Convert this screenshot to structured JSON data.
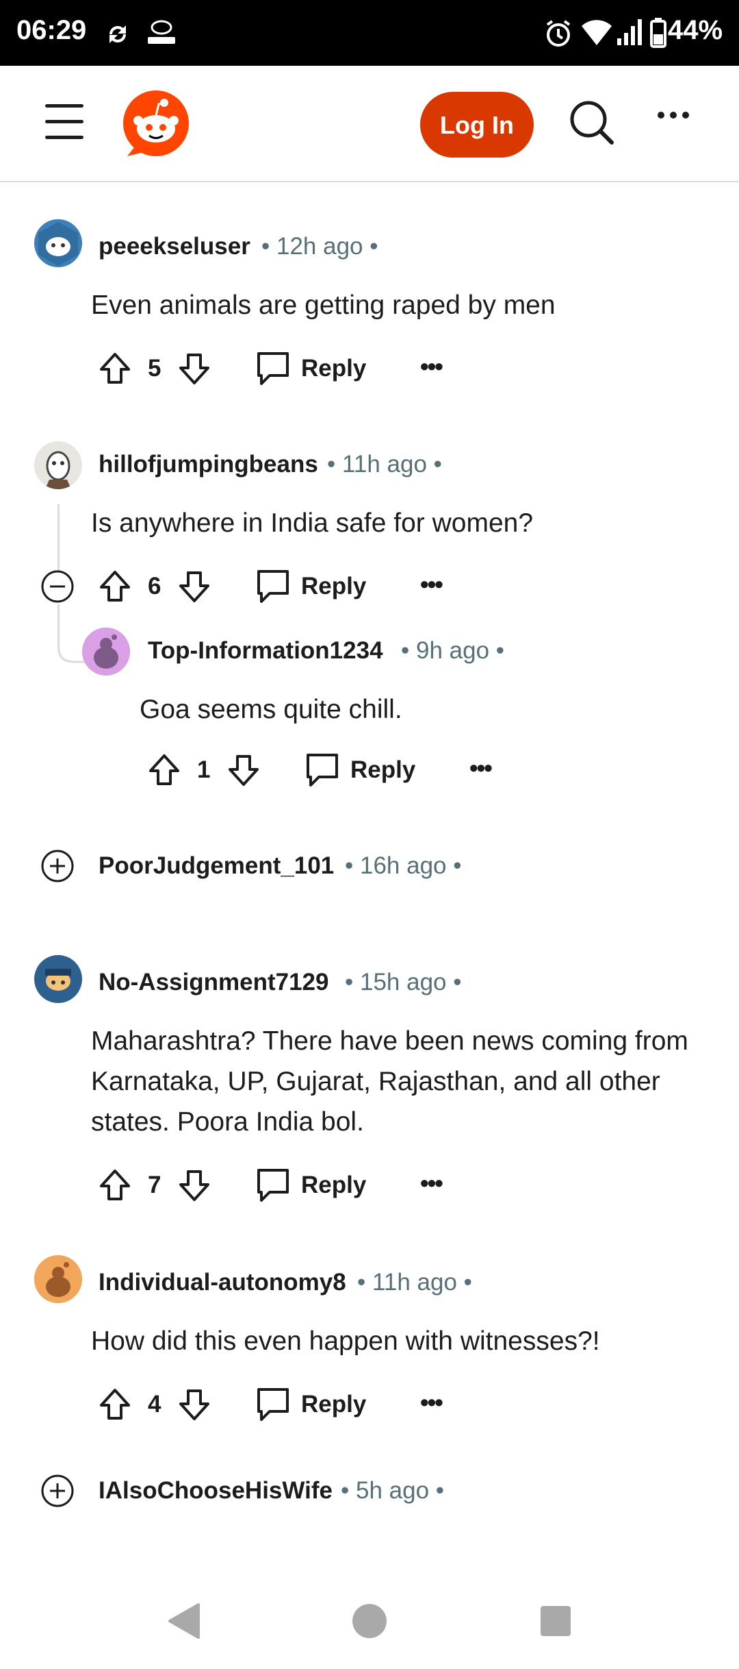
{
  "status_bar": {
    "time": "06:29",
    "battery": "44%"
  },
  "header": {
    "login_label": "Log In"
  },
  "colors": {
    "accent": "#d93900",
    "meta": "#576f76",
    "text": "#1c1c1c",
    "divider": "#d9dcdf"
  },
  "comments": [
    {
      "username": "peeekseluser",
      "time": "12h ago",
      "body": "Even animals are getting raped by men",
      "votes": "5",
      "reply": "Reply"
    },
    {
      "username": "hillofjumpingbeans",
      "time": "11h ago",
      "body": "Is anywhere in India safe for women?",
      "votes": "6",
      "reply": "Reply"
    },
    {
      "username": "Top-Information1234",
      "time": "9h ago",
      "body": "Goa seems quite chill.",
      "votes": "1",
      "reply": "Reply"
    },
    {
      "username": "PoorJudgement_101",
      "time": "16h ago"
    },
    {
      "username": "No-Assignment7129",
      "time": "15h ago",
      "body": "Maharashtra? There have been news coming from Karnataka, UP, Gujarat, Rajasthan, and all other states. Poora India bol.",
      "votes": "7",
      "reply": "Reply"
    },
    {
      "username": "Individual-autonomy8",
      "time": "11h ago",
      "body": "How did this even happen with witnesses?!",
      "votes": "4",
      "reply": "Reply"
    },
    {
      "username": "IAlsoChooseHisWife",
      "time": "5h ago"
    }
  ]
}
